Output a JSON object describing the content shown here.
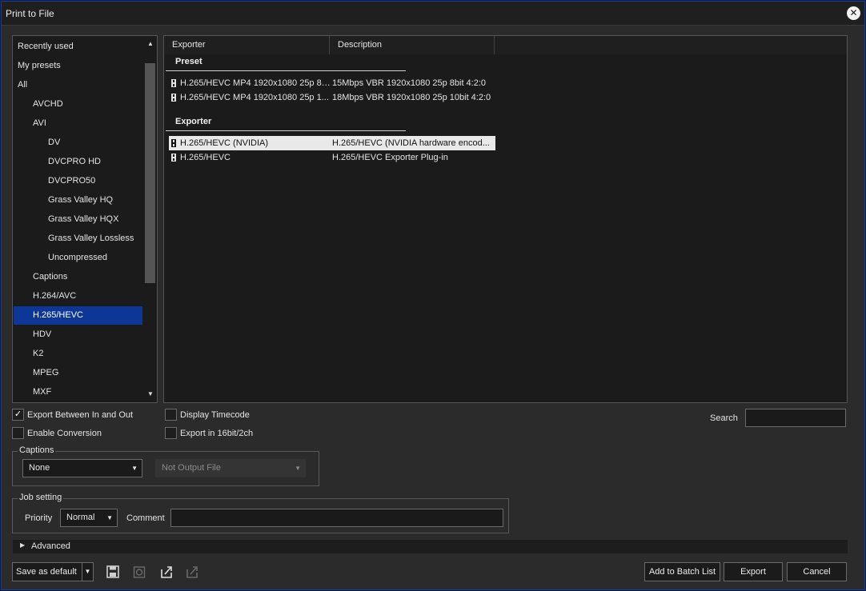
{
  "window": {
    "title": "Print to File",
    "close_icon": "close-icon"
  },
  "tree": {
    "items": [
      {
        "label": "Recently used",
        "indent": 0
      },
      {
        "label": "My presets",
        "indent": 0
      },
      {
        "label": "All",
        "indent": 0
      },
      {
        "label": "AVCHD",
        "indent": 1
      },
      {
        "label": "AVI",
        "indent": 1
      },
      {
        "label": "DV",
        "indent": 2
      },
      {
        "label": "DVCPRO HD",
        "indent": 2
      },
      {
        "label": "DVCPRO50",
        "indent": 2
      },
      {
        "label": "Grass Valley HQ",
        "indent": 2
      },
      {
        "label": "Grass Valley HQX",
        "indent": 2
      },
      {
        "label": "Grass Valley Lossless",
        "indent": 2
      },
      {
        "label": "Uncompressed",
        "indent": 2
      },
      {
        "label": "Captions",
        "indent": 1
      },
      {
        "label": "H.264/AVC",
        "indent": 1
      },
      {
        "label": "H.265/HEVC",
        "indent": 1,
        "selected": true
      },
      {
        "label": "HDV",
        "indent": 1
      },
      {
        "label": "K2",
        "indent": 1
      },
      {
        "label": "MPEG",
        "indent": 1
      },
      {
        "label": "MXF",
        "indent": 1
      }
    ]
  },
  "list": {
    "columns": [
      "Exporter",
      "Description"
    ],
    "groups": [
      {
        "label": "Preset",
        "rows": [
          {
            "exporter": "H.265/HEVC MP4 1920x1080 25p 8bit",
            "description": "15Mbps VBR 1920x1080 25p 8bit 4:2:0"
          },
          {
            "exporter": "H.265/HEVC MP4 1920x1080 25p 1...",
            "description": "18Mbps VBR 1920x1080 25p 10bit 4:2:0"
          }
        ]
      },
      {
        "label": "Exporter",
        "rows": [
          {
            "exporter": "H.265/HEVC (NVIDIA)",
            "description": "H.265/HEVC (NVIDIA hardware encod...",
            "selected": true
          },
          {
            "exporter": "H.265/HEVC",
            "description": "H.265/HEVC Exporter Plug-in"
          }
        ]
      }
    ]
  },
  "options": {
    "export_between": {
      "label": "Export Between In and Out",
      "checked": true
    },
    "enable_conversion": {
      "label": "Enable Conversion",
      "checked": false
    },
    "display_timecode": {
      "label": "Display Timecode",
      "checked": false
    },
    "export_16bit": {
      "label": "Export in 16bit/2ch",
      "checked": false
    }
  },
  "search": {
    "label": "Search",
    "value": ""
  },
  "captions": {
    "title": "Captions",
    "mode": "None",
    "output": "Not Output File"
  },
  "job": {
    "title": "Job setting",
    "priority_label": "Priority",
    "priority": "Normal",
    "comment_label": "Comment",
    "comment": ""
  },
  "advanced": {
    "label": "Advanced"
  },
  "footer": {
    "save_default": "Save as default",
    "add_batch": "Add to Batch List",
    "export": "Export",
    "cancel": "Cancel"
  }
}
